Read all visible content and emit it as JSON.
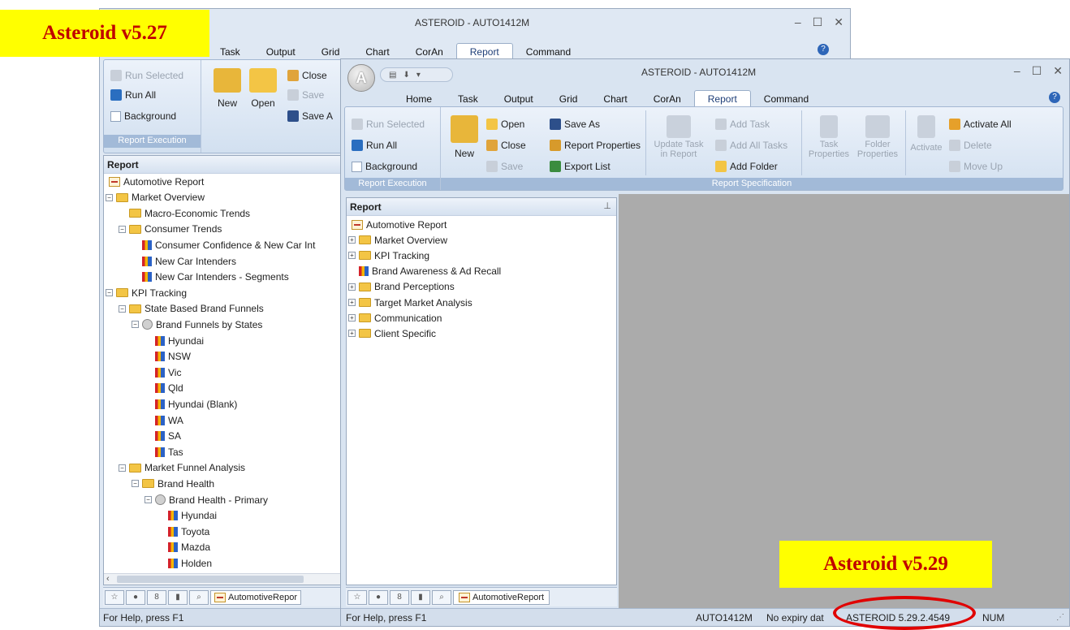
{
  "old_window": {
    "title": "ASTEROID - AUTO1412M",
    "tabs": [
      "Task",
      "Output",
      "Grid",
      "Chart",
      "CorAn",
      "Report",
      "Command"
    ],
    "active_tab": "Report",
    "ribbon": {
      "run_selected": "Run Selected",
      "run_all": "Run All",
      "background": "Background",
      "group_label": "Report Execution",
      "new": "New",
      "open": "Open",
      "close": "Close",
      "save": "Save",
      "save_as": "Save A"
    },
    "panel_title": "Report",
    "tree": [
      {
        "label": "Automotive Report",
        "kind": "report",
        "level": 0,
        "exp": ""
      },
      {
        "label": "Market Overview",
        "kind": "folder",
        "level": 0,
        "exp": "-"
      },
      {
        "label": "Macro-Economic Trends",
        "kind": "folder",
        "level": 1,
        "exp": ""
      },
      {
        "label": "Consumer Trends",
        "kind": "folder",
        "level": 1,
        "exp": "-"
      },
      {
        "label": "Consumer Confidence & New Car Int",
        "kind": "task",
        "level": 2,
        "exp": ""
      },
      {
        "label": "New Car Intenders",
        "kind": "task",
        "level": 2,
        "exp": ""
      },
      {
        "label": "New Car Intenders - Segments",
        "kind": "task",
        "level": 2,
        "exp": ""
      },
      {
        "label": "KPI Tracking",
        "kind": "folder",
        "level": 0,
        "exp": "-"
      },
      {
        "label": "State Based Brand Funnels",
        "kind": "folder",
        "level": 1,
        "exp": "-"
      },
      {
        "label": "Brand Funnels by States",
        "kind": "funnel",
        "level": 2,
        "exp": "-"
      },
      {
        "label": "Hyundai",
        "kind": "task",
        "level": 3,
        "exp": ""
      },
      {
        "label": "NSW",
        "kind": "task",
        "level": 3,
        "exp": ""
      },
      {
        "label": "Vic",
        "kind": "task",
        "level": 3,
        "exp": ""
      },
      {
        "label": "Qld",
        "kind": "task",
        "level": 3,
        "exp": ""
      },
      {
        "label": "Hyundai (Blank)",
        "kind": "task",
        "level": 3,
        "exp": ""
      },
      {
        "label": "WA",
        "kind": "task",
        "level": 3,
        "exp": ""
      },
      {
        "label": "SA",
        "kind": "task",
        "level": 3,
        "exp": ""
      },
      {
        "label": "Tas",
        "kind": "task",
        "level": 3,
        "exp": ""
      },
      {
        "label": "Market Funnel Analysis",
        "kind": "folder",
        "level": 1,
        "exp": "-"
      },
      {
        "label": "Brand Health",
        "kind": "folder",
        "level": 2,
        "exp": "-"
      },
      {
        "label": "Brand Health - Primary",
        "kind": "funnel",
        "level": 3,
        "exp": "-"
      },
      {
        "label": "Hyundai",
        "kind": "task",
        "level": 4,
        "exp": ""
      },
      {
        "label": "Toyota",
        "kind": "task",
        "level": 4,
        "exp": ""
      },
      {
        "label": "Mazda",
        "kind": "task",
        "level": 4,
        "exp": ""
      },
      {
        "label": "Holden",
        "kind": "task",
        "level": 4,
        "exp": ""
      }
    ],
    "bottom_tab": "AutomotiveRepor",
    "status": "For Help, press F1"
  },
  "new_window": {
    "title": "ASTEROID - AUTO1412M",
    "tabs": [
      "Home",
      "Task",
      "Output",
      "Grid",
      "Chart",
      "CorAn",
      "Report",
      "Command"
    ],
    "active_tab": "Report",
    "ribbon": {
      "run_selected": "Run Selected",
      "run_all": "Run All",
      "background": "Background",
      "group_exec": "Report Execution",
      "new": "New",
      "open": "Open",
      "close": "Close",
      "save": "Save",
      "save_as": "Save As",
      "report_properties": "Report Properties",
      "export_list": "Export List",
      "update_task_1": "Update Task",
      "update_task_2": "in Report",
      "add_task": "Add Task",
      "add_all_tasks": "Add All Tasks",
      "add_folder": "Add Folder",
      "task_1": "Task",
      "task_2": "Properties",
      "folder_1": "Folder",
      "folder_2": "Properties",
      "activate": "Activate",
      "activate_all": "Activate All",
      "delete": "Delete",
      "move_up": "Move Up",
      "group_spec": "Report Specification"
    },
    "panel_title": "Report",
    "tree": [
      {
        "label": "Automotive Report",
        "kind": "report",
        "exp": ""
      },
      {
        "label": "Market Overview",
        "kind": "folder",
        "exp": "+"
      },
      {
        "label": "KPI Tracking",
        "kind": "folder",
        "exp": "+"
      },
      {
        "label": "Brand Awareness & Ad Recall",
        "kind": "task",
        "exp": ""
      },
      {
        "label": "Brand Perceptions",
        "kind": "folder",
        "exp": "+"
      },
      {
        "label": "Target Market Analysis",
        "kind": "folder",
        "exp": "+"
      },
      {
        "label": "Communication",
        "kind": "folder",
        "exp": "+"
      },
      {
        "label": "Client Specific",
        "kind": "folder",
        "exp": "+"
      }
    ],
    "bottom_tab": "AutomotiveReport",
    "status": {
      "help": "For Help, press F1",
      "file": "AUTO1412M",
      "expiry": "No expiry dat",
      "version": "ASTEROID 5.29.2.4549",
      "num": "NUM"
    }
  },
  "labels": {
    "old_version": "Asteroid v5.27",
    "new_version": "Asteroid v5.29"
  },
  "colors": {
    "highlight_tag": "#ffff00",
    "tag_text": "#c00000",
    "callout_ring": "#e00000"
  }
}
